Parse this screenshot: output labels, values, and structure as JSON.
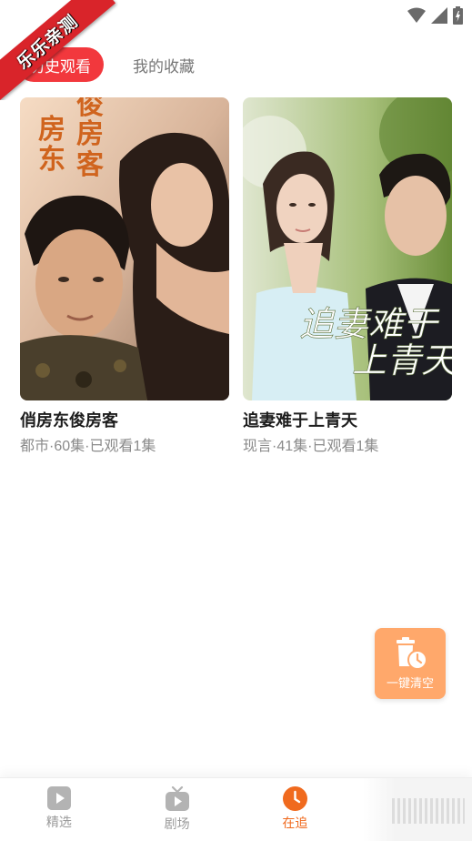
{
  "ribbon": {
    "text": "乐乐亲测"
  },
  "tabs": [
    {
      "label": "历史观看",
      "active": true
    },
    {
      "label": "我的收藏",
      "active": false
    }
  ],
  "cards": [
    {
      "title": "俏房东俊房客",
      "meta": "都市·60集·已观看1集",
      "poster_text": "俏房东俊房客"
    },
    {
      "title": "追妻难于上青天",
      "meta": "现言·41集·已观看1集",
      "poster_text": "追妻难于上青天"
    }
  ],
  "fab": {
    "label": "一键清空"
  },
  "bottom_nav": {
    "items": [
      {
        "label": "精选",
        "icon": "play-icon"
      },
      {
        "label": "剧场",
        "icon": "tv-icon"
      },
      {
        "label": "在追",
        "icon": "clock-icon",
        "active": true
      }
    ]
  },
  "colors": {
    "accent": "#f2383d",
    "fab": "#ffa86b",
    "nav_active": "#f06a1e"
  }
}
